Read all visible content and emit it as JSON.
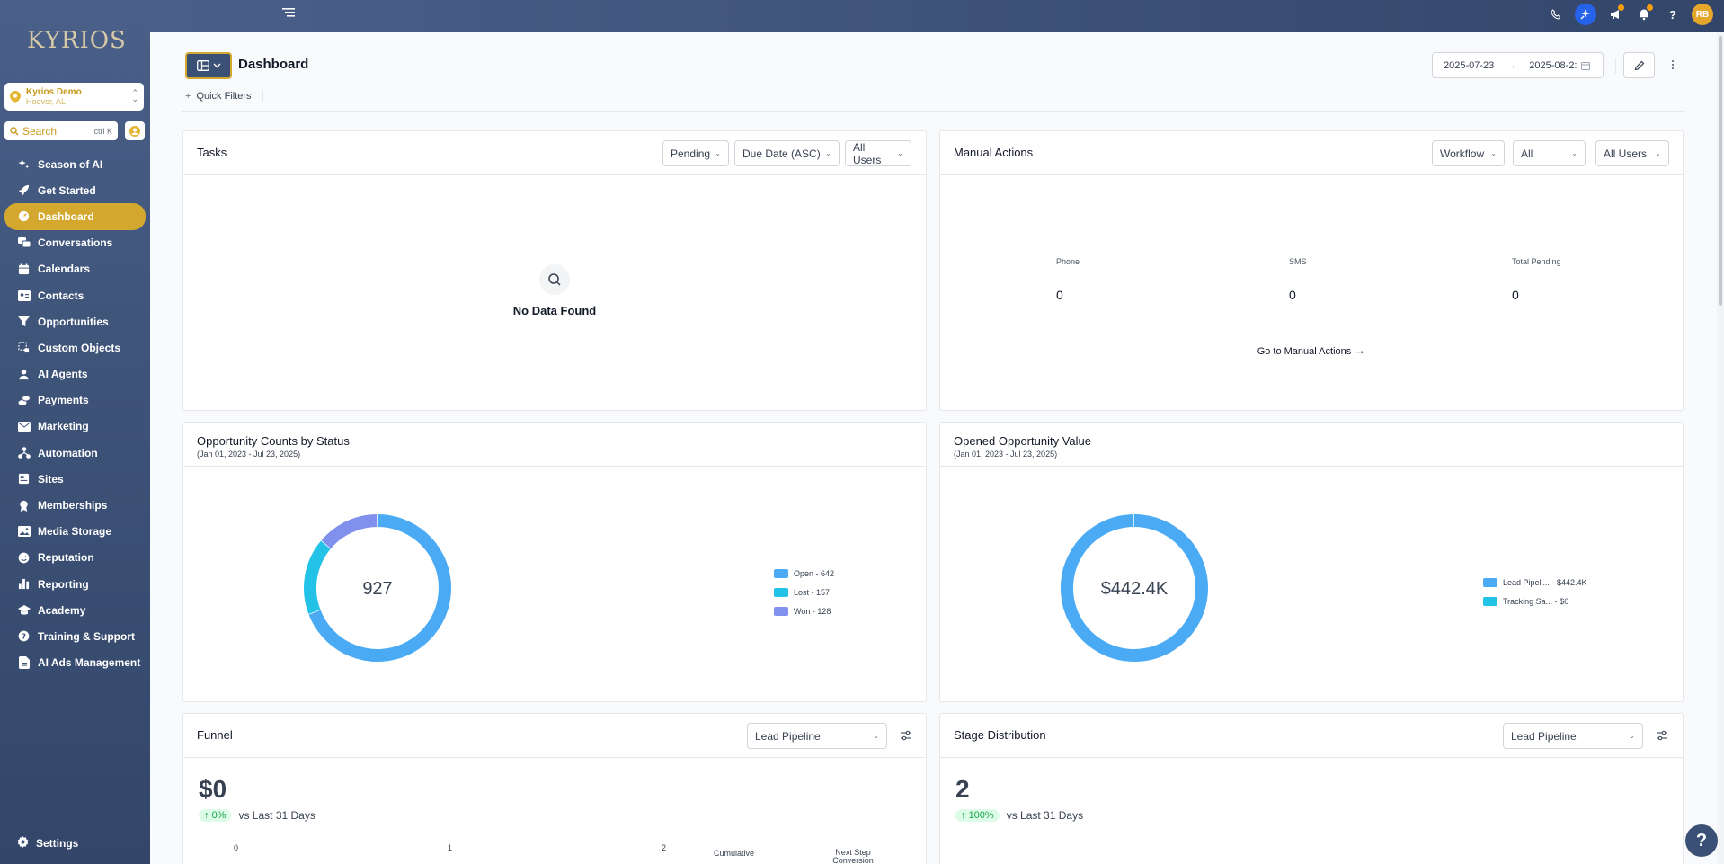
{
  "brand": {
    "logo": "KYRIOS",
    "accent": "#d4a82f",
    "sidebar_bg": "#3f5479"
  },
  "location": {
    "name": "Kyrios Demo",
    "sub": "Hoover, AL"
  },
  "search": {
    "placeholder": "Search",
    "shortcut": "ctrl K"
  },
  "nav": [
    {
      "label": "Season of AI",
      "icon": "sparkle-icon"
    },
    {
      "label": "Get Started",
      "icon": "rocket-icon"
    },
    {
      "label": "Dashboard",
      "icon": "gauge-icon",
      "active": true
    },
    {
      "label": "Conversations",
      "icon": "chat-icon"
    },
    {
      "label": "Calendars",
      "icon": "calendar-icon"
    },
    {
      "label": "Contacts",
      "icon": "contact-card-icon"
    },
    {
      "label": "Opportunities",
      "icon": "funnel-icon"
    },
    {
      "label": "Custom Objects",
      "icon": "cube-icon"
    },
    {
      "label": "AI Agents",
      "icon": "robot-icon"
    },
    {
      "label": "Payments",
      "icon": "coins-icon"
    },
    {
      "label": "Marketing",
      "icon": "mail-icon"
    },
    {
      "label": "Automation",
      "icon": "flow-icon"
    },
    {
      "label": "Sites",
      "icon": "site-icon"
    },
    {
      "label": "Memberships",
      "icon": "badge-icon"
    },
    {
      "label": "Media Storage",
      "icon": "image-icon"
    },
    {
      "label": "Reputation",
      "icon": "smile-icon"
    },
    {
      "label": "Reporting",
      "icon": "bar-chart-icon"
    },
    {
      "label": "Academy",
      "icon": "graduation-icon"
    },
    {
      "label": "Training & Support",
      "icon": "help-circle-icon"
    },
    {
      "label": "AI Ads Management",
      "icon": "document-icon"
    }
  ],
  "settings": {
    "label": "Settings"
  },
  "user": {
    "initials": "RB"
  },
  "header": {
    "title": "Dashboard",
    "quick_filters": "Quick Filters",
    "date_from": "2025-07-23",
    "date_to": "2025-08-2:"
  },
  "tasks": {
    "title": "Tasks",
    "filter_status": "Pending",
    "filter_sort": "Due Date (ASC)",
    "filter_users": "All Users",
    "empty": "No Data Found"
  },
  "manual_actions": {
    "title": "Manual Actions",
    "filter_workflow": "Workflow",
    "filter_all": "All",
    "filter_users": "All Users",
    "cols": [
      {
        "label": "Phone",
        "value": "0"
      },
      {
        "label": "SMS",
        "value": "0"
      },
      {
        "label": "Total Pending",
        "value": "0"
      }
    ],
    "link": "Go to Manual Actions"
  },
  "opp_counts": {
    "title": "Opportunity Counts by Status",
    "subtitle": "(Jan 01, 2023 - Jul 23, 2025)",
    "center": "927",
    "legend": [
      "Open - 642",
      "Lost - 157",
      "Won - 128"
    ]
  },
  "opp_value": {
    "title": "Opened Opportunity Value",
    "subtitle": "(Jan 01, 2023 - Jul 23, 2025)",
    "center": "$442.4K",
    "legend": [
      "Lead Pipeli... - $442.4K",
      "Tracking Sa... - $0"
    ]
  },
  "funnel": {
    "title": "Funnel",
    "pipeline": "Lead Pipeline",
    "big": "$0",
    "pct": "0%",
    "vs": "vs Last 31 Days",
    "ticks": [
      "0",
      "1",
      "2"
    ],
    "col1": "Cumulative",
    "col2": "Next Step Conversion"
  },
  "stage": {
    "title": "Stage Distribution",
    "pipeline": "Lead Pipeline",
    "big": "2",
    "pct": "100%",
    "vs": "vs Last 31 Days"
  },
  "chart_data": [
    {
      "type": "pie",
      "title": "Opportunity Counts by Status",
      "subtitle": "(Jan 01, 2023 - Jul 23, 2025)",
      "categories": [
        "Open",
        "Lost",
        "Won"
      ],
      "values": [
        642,
        157,
        128
      ],
      "colors": [
        "#4aaaf3",
        "#22c3e6",
        "#8190ec"
      ],
      "center_label": "927",
      "legend": "right"
    },
    {
      "type": "pie",
      "title": "Opened Opportunity Value",
      "subtitle": "(Jan 01, 2023 - Jul 23, 2025)",
      "categories": [
        "Lead Pipeli...",
        "Tracking Sa..."
      ],
      "values": [
        442.4,
        0
      ],
      "colors": [
        "#4aaaf3",
        "#22c3e6"
      ],
      "center_label": "$442.4K",
      "legend": "right"
    }
  ]
}
